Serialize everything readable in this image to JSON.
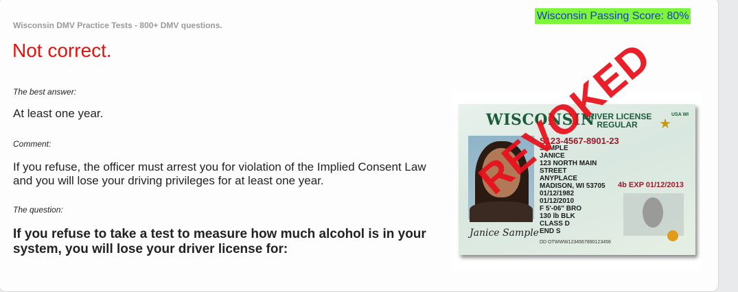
{
  "header": {
    "subtitle": "Wisconsin DMV Practice Tests - 800+ DMV questions.",
    "passing_score": "Wisconsin Passing Score: 80%"
  },
  "result": {
    "verdict": "Not correct."
  },
  "best_answer": {
    "label": "The best answer:",
    "text": "At least one year."
  },
  "comment": {
    "label": "Comment:",
    "text": "If you refuse, the officer must arrest you for violation of the Implied Consent Law and you will lose your driving privileges for at least one year."
  },
  "question": {
    "label": "The question:",
    "text": "If you refuse to take a test to measure how much alcohol is in your system, you will lose your driver license for:"
  },
  "license_image": {
    "state": "WISCONSIN",
    "type_line1": "DRIVER LICENSE",
    "type_line2": "REGULAR",
    "usa": "USA WI",
    "number": "S123-4567-8901-23",
    "name1": "SAMPLE",
    "name2": "JANICE",
    "addr1": "123 NORTH MAIN STREET",
    "addr2": "ANYPLACE",
    "addr3": "MADISON, WI 53705",
    "dob": "01/12/1982",
    "exp": "4b EXP 01/12/2013",
    "iss": "01/12/2010",
    "sex_hgt": "F  5'-06\"  BRO",
    "wgt_hair": "130 lb  BLK",
    "class": "CLASS D",
    "end": "END S",
    "dd": "DD OTWWW1234567890123456",
    "signature": "Janice Sample",
    "stamp": "REVOKED"
  }
}
